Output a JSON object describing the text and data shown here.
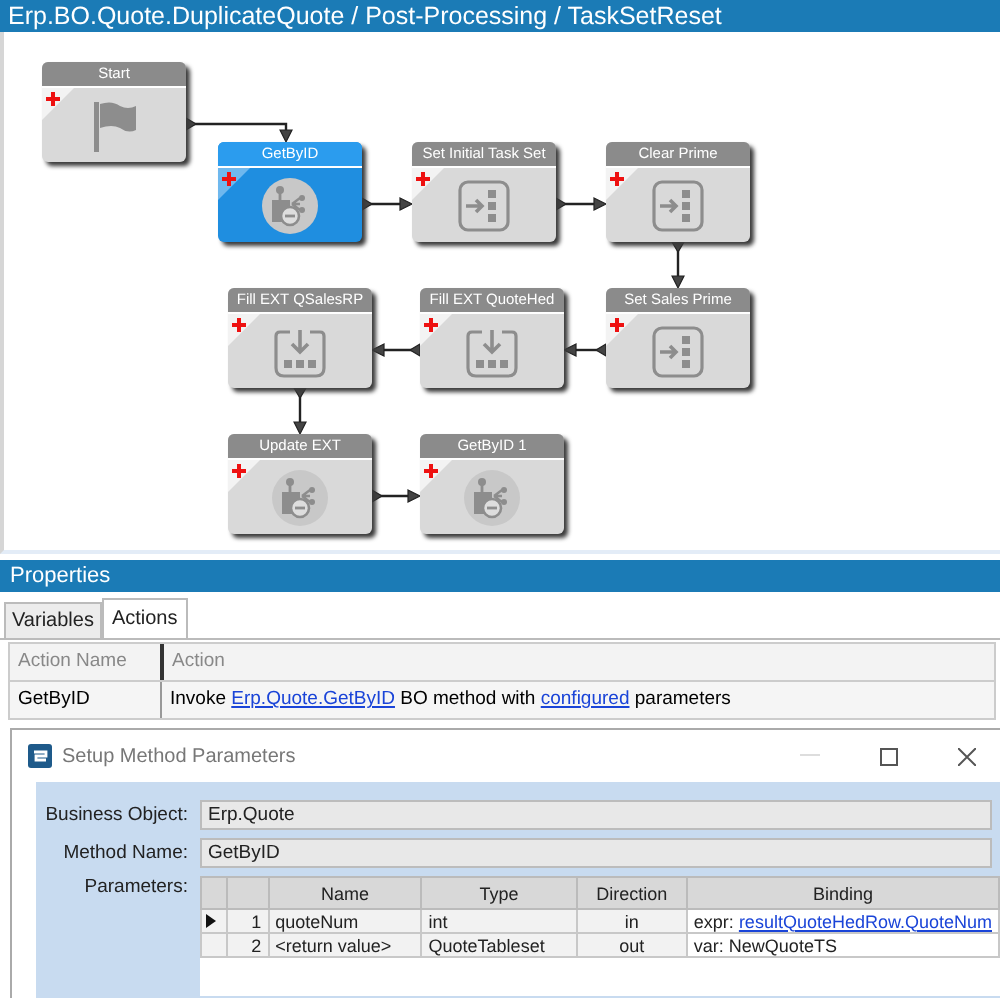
{
  "header": {
    "breadcrumb": "Erp.BO.Quote.DuplicateQuote / Post-Processing / TaskSetReset"
  },
  "workflow": {
    "nodes": [
      {
        "title": "Start",
        "kind": "start",
        "selected": false
      },
      {
        "title": "GetByID",
        "kind": "method",
        "selected": true
      },
      {
        "title": "Set Initial Task Set",
        "kind": "set",
        "selected": false
      },
      {
        "title": "Clear Prime",
        "kind": "set",
        "selected": false
      },
      {
        "title": "Fill EXT QSalesRP",
        "kind": "fill",
        "selected": false
      },
      {
        "title": "Fill EXT QuoteHed",
        "kind": "fill",
        "selected": false
      },
      {
        "title": "Set Sales Prime",
        "kind": "set",
        "selected": false
      },
      {
        "title": "Update EXT",
        "kind": "method",
        "selected": false
      },
      {
        "title": "GetByID 1",
        "kind": "method",
        "selected": false
      }
    ]
  },
  "properties": {
    "title": "Properties",
    "tabs": [
      {
        "label": "Variables",
        "selected": false
      },
      {
        "label": "Actions",
        "selected": true
      }
    ],
    "columns": [
      "Action Name",
      "Action"
    ],
    "rows": [
      {
        "name": "GetByID",
        "action": [
          {
            "text": "Invoke ",
            "link": false
          },
          {
            "text": "Erp.Quote.GetByID",
            "link": true
          },
          {
            "text": " BO method with ",
            "link": false
          },
          {
            "text": "configured",
            "link": true
          },
          {
            "text": " parameters",
            "link": false
          }
        ]
      }
    ]
  },
  "dialog": {
    "title": "Setup Method Parameters",
    "fields": [
      {
        "label": "Business Object:",
        "value": "Erp.Quote"
      },
      {
        "label": "Method Name:",
        "value": "GetByID"
      }
    ],
    "parameters_label": "Parameters:",
    "columns": [
      "Name",
      "Type",
      "Direction",
      "Binding"
    ],
    "rows": [
      {
        "number": "1",
        "name": "quoteNum",
        "type": "int",
        "direction": "in",
        "binding": [
          {
            "text": "expr: ",
            "link": false
          },
          {
            "text": "resultQuoteHedRow.QuoteNum",
            "link": true
          }
        ],
        "selected": true
      },
      {
        "number": "2",
        "name": "<return value>",
        "type": "QuoteTableset",
        "direction": "out",
        "binding": [
          {
            "text": "var: NewQuoteTS",
            "link": false
          }
        ],
        "selected": false
      }
    ]
  }
}
